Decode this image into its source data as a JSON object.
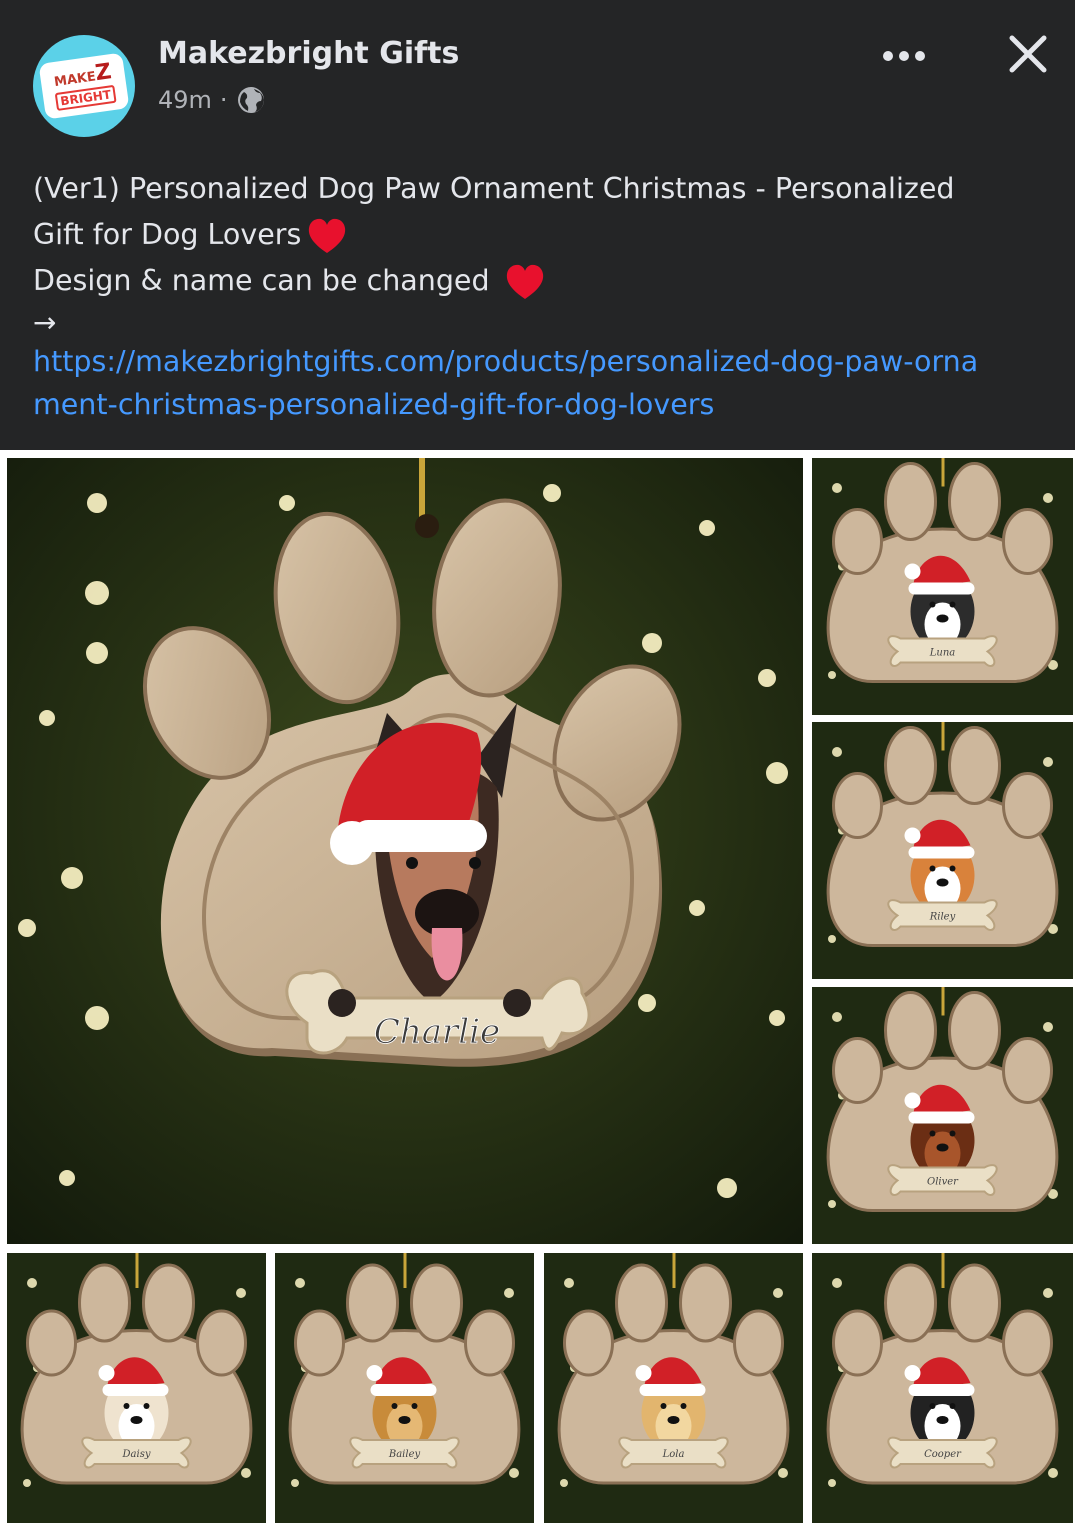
{
  "post": {
    "page_name": "Makezbright Gifts",
    "time": "49m",
    "separator": "·",
    "privacy_icon": "globe-icon",
    "avatar_text_top": "MAKE",
    "avatar_text_z": "Z",
    "avatar_text_bottom": "BRIGHT",
    "text_line1": "(Ver1) Personalized Dog Paw Ornament Christmas - Personalized",
    "text_line2": "Gift for Dog Lovers",
    "text_line3": "Design & name can be changed",
    "arrow": "→",
    "link_line1": "https://makezbrightgifts.com/products/personalized-dog-paw-orna",
    "link_line2": "ment-christmas-personalized-gift-for-dog-lovers"
  },
  "actions": {
    "more_icon": "more-options-icon",
    "close_icon": "close-icon"
  },
  "gallery": {
    "main_name": "Charlie",
    "thumbnails": [
      {
        "dog": "husky",
        "name": "Luna"
      },
      {
        "dog": "corgi",
        "name": "Riley"
      },
      {
        "dog": "dachshund",
        "name": "Oliver"
      },
      {
        "dog": "labrador",
        "name": "Daisy"
      },
      {
        "dog": "golden-retriever",
        "name": "Bailey"
      },
      {
        "dog": "goldendoodle",
        "name": "Lola"
      },
      {
        "dog": "french-bulldog",
        "name": "Cooper"
      }
    ]
  },
  "colors": {
    "background": "#242526",
    "text": "#e4e6eb",
    "secondary_text": "#b0b3b8",
    "link": "#4599ff",
    "heart": "#e8112d",
    "wood": "#cdb79c"
  }
}
